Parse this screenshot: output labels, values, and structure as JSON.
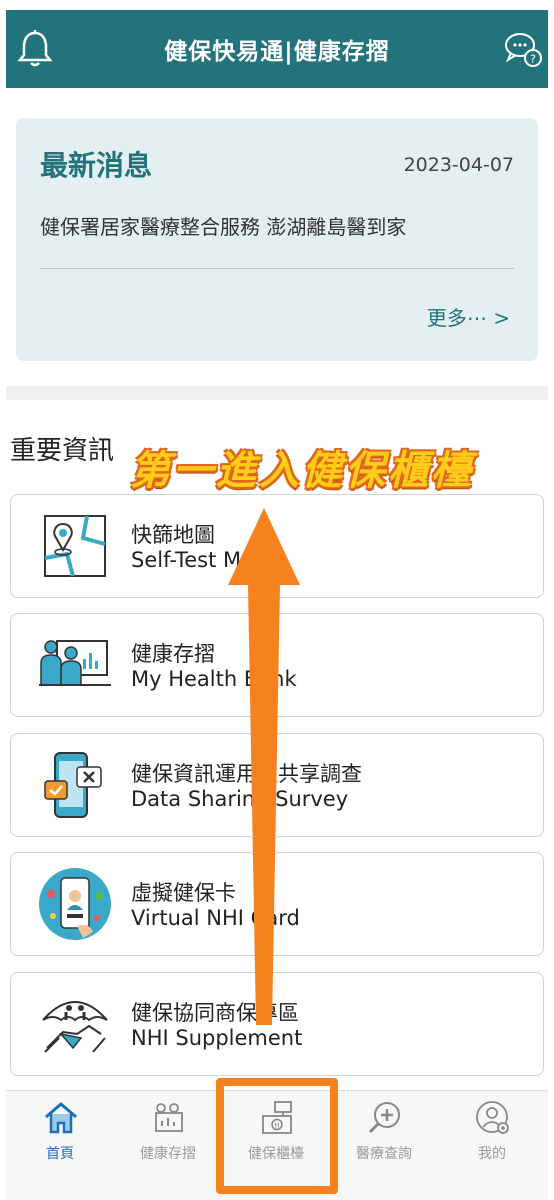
{
  "header": {
    "title": "健保快易通|健康存摺",
    "left_icon": "bell-icon",
    "right_icon": "chat-help-icon",
    "color": "#22737b"
  },
  "news": {
    "title": "最新消息",
    "date": "2023-04-07",
    "text": "健保署居家醫療整合服務 澎湖離島醫到家",
    "more": "更多⋯ >"
  },
  "important": {
    "title": "重要資訊",
    "items": [
      {
        "zh": "快篩地圖",
        "en": "Self-Test M",
        "icon": "map-pin-icon"
      },
      {
        "zh": "健康存摺",
        "en": "My Health Bank",
        "icon": "health-bank-icon"
      },
      {
        "zh": "健保資訊運用及共享調查",
        "en": "Data Sharing Survey",
        "icon": "phone-survey-icon"
      },
      {
        "zh": "虛擬健保卡",
        "en": "Virtual NHI Card",
        "icon": "virtual-card-icon"
      },
      {
        "zh": "健保協同商保專區",
        "en": "NHI Supplement",
        "icon": "umbrella-handshake-icon"
      }
    ]
  },
  "annotation": {
    "text": "第一進入健保櫃檯",
    "color": "#f5821f"
  },
  "tabs": [
    {
      "label": "首頁",
      "icon": "home-icon",
      "active": true
    },
    {
      "label": "健康存摺",
      "icon": "health-record-icon",
      "active": false
    },
    {
      "label": "健保櫃檯",
      "icon": "counter-icon",
      "active": false
    },
    {
      "label": "醫療查詢",
      "icon": "medical-search-icon",
      "active": false
    },
    {
      "label": "我的",
      "icon": "profile-settings-icon",
      "active": false
    }
  ]
}
